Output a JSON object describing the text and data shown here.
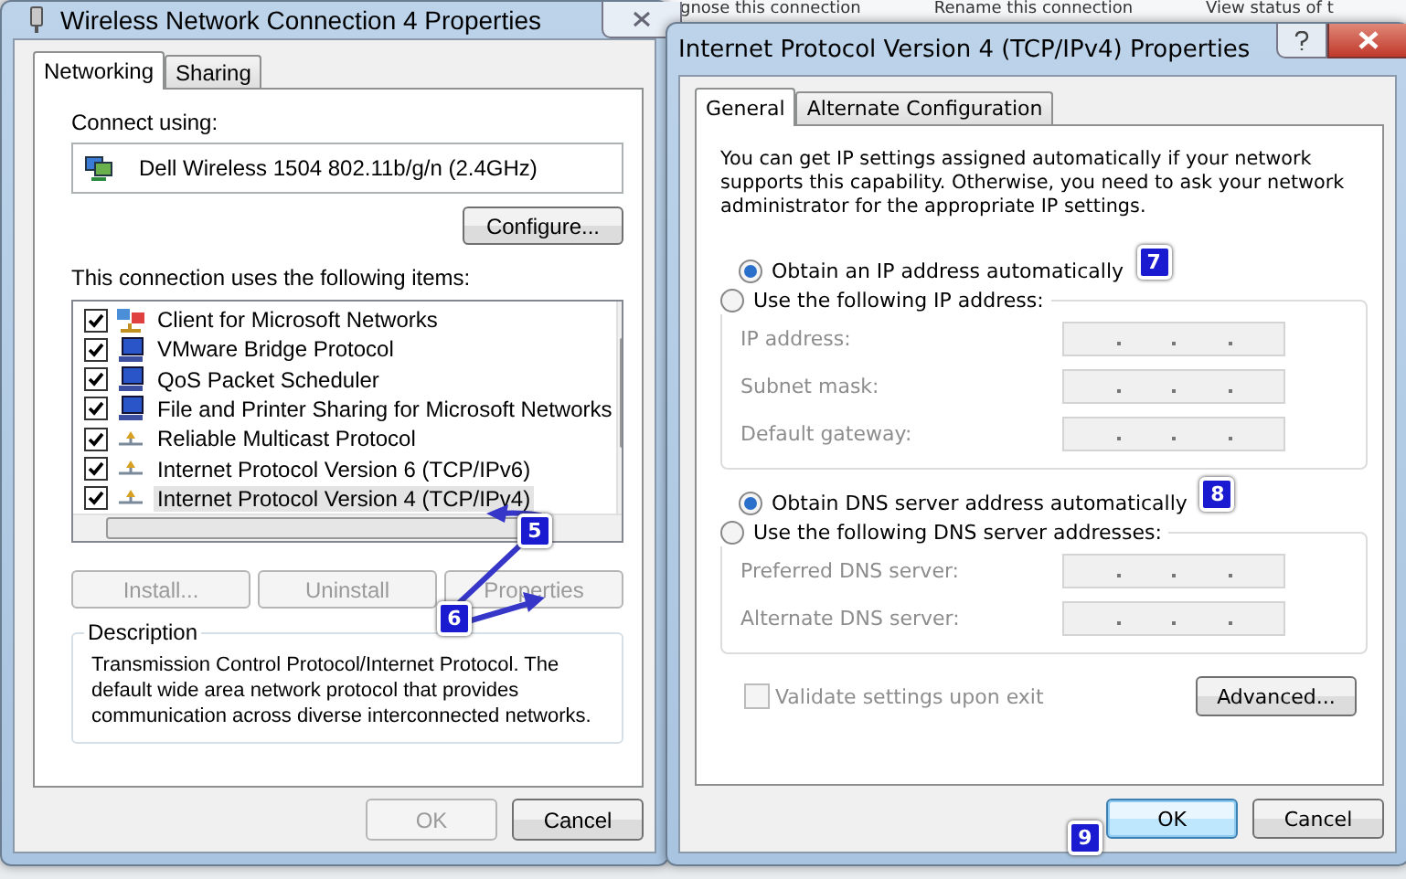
{
  "background_toolbar": [
    "gnose this connection",
    "Rename this connection",
    "View status of t"
  ],
  "left_window": {
    "title": "Wireless Network Connection 4 Properties",
    "tabs": [
      {
        "label": "Networking",
        "selected": true
      },
      {
        "label": "Sharing",
        "selected": false
      }
    ],
    "connect_using_label": "Connect using:",
    "adapter": "Dell Wireless 1504 802.11b/g/n (2.4GHz)",
    "configure_button": "Configure...",
    "items_label": "This connection uses the following items:",
    "items": [
      {
        "label": "Client for Microsoft Networks",
        "kind": "client",
        "checked": true,
        "selected": false
      },
      {
        "label": "VMware Bridge Protocol",
        "kind": "service",
        "checked": true,
        "selected": false
      },
      {
        "label": "QoS Packet Scheduler",
        "kind": "service",
        "checked": true,
        "selected": false
      },
      {
        "label": "File and Printer Sharing for Microsoft Networks",
        "kind": "service",
        "checked": true,
        "selected": false
      },
      {
        "label": "Reliable Multicast Protocol",
        "kind": "protocol",
        "checked": true,
        "selected": false
      },
      {
        "label": "Internet Protocol Version 6 (TCP/IPv6)",
        "kind": "protocol",
        "checked": true,
        "selected": false
      },
      {
        "label": "Internet Protocol Version 4 (TCP/IPv4)",
        "kind": "protocol",
        "checked": true,
        "selected": true
      }
    ],
    "buttons": [
      {
        "label": "Install...",
        "disabled": true
      },
      {
        "label": "Uninstall",
        "disabled": true
      },
      {
        "label": "Properties",
        "disabled": true
      }
    ],
    "description": {
      "title": "Description",
      "text": "Transmission Control Protocol/Internet Protocol. The default wide area network protocol that provides communication across diverse interconnected networks."
    },
    "footer_buttons": [
      {
        "label": "OK",
        "disabled": true
      },
      {
        "label": "Cancel",
        "disabled": false
      }
    ]
  },
  "right_window": {
    "title": "Internet Protocol Version 4 (TCP/IPv4) Properties",
    "tabs": [
      {
        "label": "General",
        "selected": true
      },
      {
        "label": "Alternate Configuration",
        "selected": false
      }
    ],
    "intro": "You can get IP settings assigned automatically if your network supports this capability. Otherwise, you need to ask your network administrator for the appropriate IP settings.",
    "ip_options": [
      {
        "label": "Obtain an IP address automatically",
        "selected": true
      },
      {
        "label": "Use the following IP address:",
        "selected": false
      }
    ],
    "ip_fields": [
      {
        "label": "IP address:",
        "disabled": true
      },
      {
        "label": "Subnet mask:",
        "disabled": true
      },
      {
        "label": "Default gateway:",
        "disabled": true
      }
    ],
    "dns_options": [
      {
        "label": "Obtain DNS server address automatically",
        "selected": true
      },
      {
        "label": "Use the following DNS server addresses:",
        "selected": false
      }
    ],
    "dns_fields": [
      {
        "label": "Preferred DNS server:",
        "disabled": true
      },
      {
        "label": "Alternate DNS server:",
        "disabled": true
      }
    ],
    "validate": {
      "label": "Validate settings upon exit",
      "checked": false,
      "disabled": true
    },
    "advanced_button": "Advanced...",
    "footer_buttons": [
      {
        "label": "OK",
        "focused": true
      },
      {
        "label": "Cancel",
        "focused": false
      }
    ]
  },
  "annotations": [
    {
      "number": "5"
    },
    {
      "number": "6"
    },
    {
      "number": "7"
    },
    {
      "number": "8"
    },
    {
      "number": "9"
    }
  ]
}
